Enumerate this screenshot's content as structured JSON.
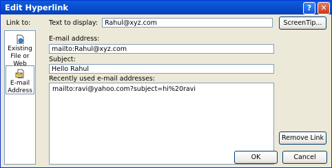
{
  "window": {
    "title": "Edit Hyperlink",
    "help_glyph": "?",
    "close_glyph": "✕"
  },
  "link_to": {
    "label": "Link to:",
    "items": [
      {
        "label": "Existing File or Web Page",
        "icon": "document-globe-icon"
      },
      {
        "label": "E-mail Address",
        "icon": "envelope-icon",
        "selected": true
      }
    ]
  },
  "text_to_display": {
    "label": "Text to display:",
    "value": "Rahul@xyz.com"
  },
  "screentip_button": "ScreenTip...",
  "email_address": {
    "label": "E-mail address:",
    "value": "mailto:Rahul@xyz.com"
  },
  "subject": {
    "label": "Subject:",
    "value": "Hello Rahul"
  },
  "recent": {
    "label": "Recently used e-mail addresses:",
    "items": [
      "mailto:ravi@yahoo.com?subject=hi%20ravi"
    ]
  },
  "buttons": {
    "remove_link": "Remove Link",
    "ok": "OK",
    "cancel": "Cancel"
  }
}
